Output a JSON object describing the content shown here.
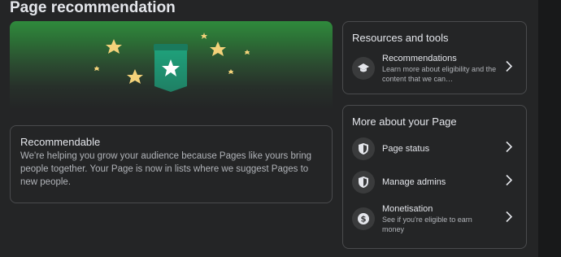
{
  "page": {
    "title": "Page recommendation"
  },
  "recommendable": {
    "title": "Recommendable",
    "body": "We're helping you grow your audience because Pages like yours bring people together. Your Page is now in lists where we suggest Pages to new people."
  },
  "resources": {
    "title": "Resources and tools",
    "items": [
      {
        "label": "Recommendations",
        "sub": "Learn more about eligibility and the content that we can…",
        "icon": "graduation-cap-icon"
      }
    ]
  },
  "more": {
    "title": "More about your Page",
    "items": [
      {
        "label": "Page status",
        "icon": "shield-icon"
      },
      {
        "label": "Manage admins",
        "icon": "shield-icon"
      },
      {
        "label": "Monetisation",
        "sub": "See if you're eligible to earn money",
        "icon": "dollar-icon"
      }
    ]
  },
  "colors": {
    "background": "#242526",
    "border": "#4a4b4d",
    "banner_green": "#2f8a3c",
    "badge": "#2a9d6e",
    "star": "#f3d27a"
  }
}
